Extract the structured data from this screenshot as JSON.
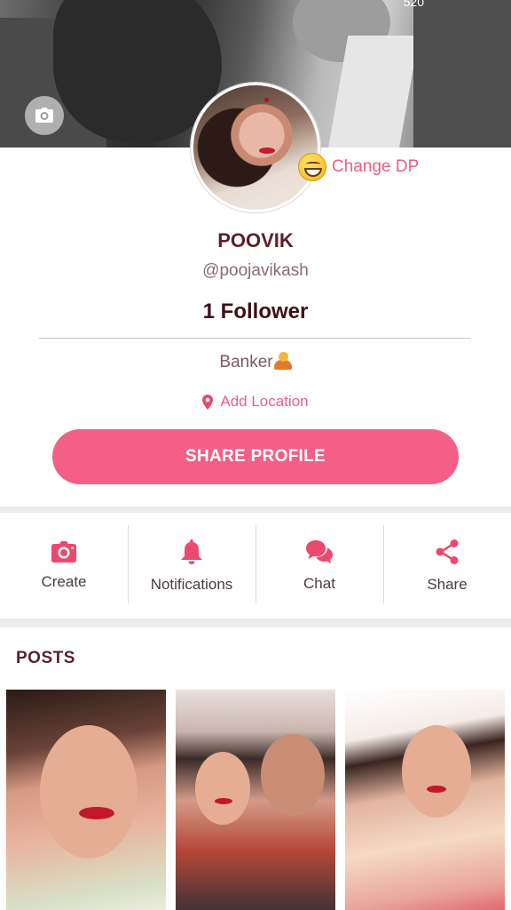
{
  "cover": {
    "count": "520"
  },
  "profile": {
    "change_dp_label": "Change DP",
    "name": "POOVIK",
    "handle": "@poojavikash",
    "followers": "1 Follower",
    "bio": "Banker",
    "add_location_label": "Add Location",
    "share_profile_label": "SHARE PROFILE"
  },
  "actions": [
    {
      "label": "Create",
      "icon": "camera-icon"
    },
    {
      "label": "Notifications",
      "icon": "bell-icon"
    },
    {
      "label": "Chat",
      "icon": "chat-bubbles-icon"
    },
    {
      "label": "Share",
      "icon": "share-icon"
    }
  ],
  "posts": {
    "title": "POSTS",
    "count_visible": 3
  },
  "colors": {
    "accent": "#f35f86",
    "accent_text": "#e95f83",
    "title": "#5a1f2b",
    "icon": "#ea4a6e"
  }
}
